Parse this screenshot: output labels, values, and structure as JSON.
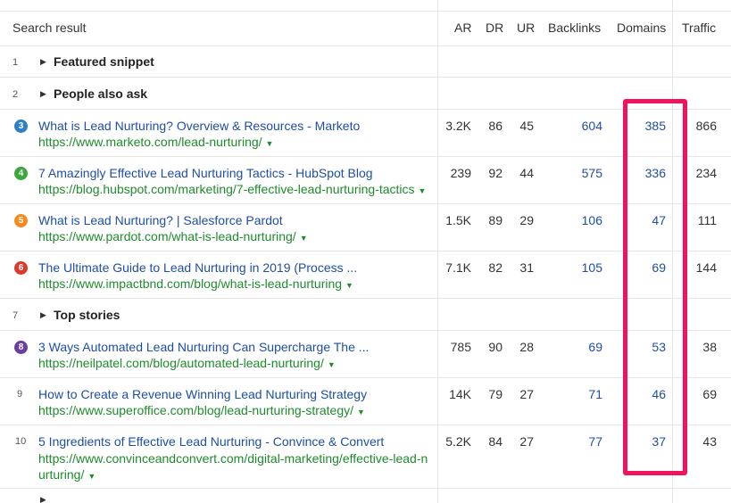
{
  "header": {
    "search_result": "Search result",
    "ar": "AR",
    "dr": "DR",
    "ur": "UR",
    "backlinks": "Backlinks",
    "domains": "Domains",
    "traffic": "Traffic"
  },
  "sections": [
    {
      "index": "1",
      "label": "Featured snippet"
    },
    {
      "index": "2",
      "label": "People also ask"
    },
    {
      "index": "7",
      "label": "Top stories"
    }
  ],
  "results": [
    {
      "pos": "3",
      "color": "#2e7fc6",
      "title": "What is Lead Nurturing? Overview & Resources - Marketo",
      "url": "https://www.marketo.com/lead-nurturing/",
      "ar": "3.2K",
      "dr": "86",
      "ur": "45",
      "backlinks": "604",
      "domains": "385",
      "traffic": "866"
    },
    {
      "pos": "4",
      "color": "#3aa83a",
      "title": "7 Amazingly Effective Lead Nurturing Tactics - HubSpot Blog",
      "url": "https://blog.hubspot.com/marketing/7-effective-lead-nurturing-tactics",
      "ar": "239",
      "dr": "92",
      "ur": "44",
      "backlinks": "575",
      "domains": "336",
      "traffic": "234"
    },
    {
      "pos": "5",
      "color": "#f58a1f",
      "title": "What is Lead Nurturing? | Salesforce Pardot",
      "url": "https://www.pardot.com/what-is-lead-nurturing/",
      "ar": "1.5K",
      "dr": "89",
      "ur": "29",
      "backlinks": "106",
      "domains": "47",
      "traffic": "111"
    },
    {
      "pos": "6",
      "color": "#d93a2b",
      "title": "The Ultimate Guide to Lead Nurturing in 2019 (Process ...",
      "url": "https://www.impactbnd.com/blog/what-is-lead-nurturing",
      "ar": "7.1K",
      "dr": "82",
      "ur": "31",
      "backlinks": "105",
      "domains": "69",
      "traffic": "144"
    },
    {
      "pos": "8",
      "color": "#6b3fa0",
      "title": "3 Ways Automated Lead Nurturing Can Supercharge The ...",
      "url": "https://neilpatel.com/blog/automated-lead-nurturing/",
      "ar": "785",
      "dr": "90",
      "ur": "28",
      "backlinks": "69",
      "domains": "53",
      "traffic": "38"
    },
    {
      "pos": "9",
      "color": "",
      "title": "How to Create a Revenue Winning Lead Nurturing Strategy",
      "url": "https://www.superoffice.com/blog/lead-nurturing-strategy/",
      "ar": "14K",
      "dr": "79",
      "ur": "27",
      "backlinks": "71",
      "domains": "46",
      "traffic": "69"
    },
    {
      "pos": "10",
      "color": "",
      "title": "5 Ingredients of Effective Lead Nurturing - Convince & Convert",
      "url": "https://www.convinceandconvert.com/digital-marketing/effective-lead-nurturing/",
      "ar": "5.2K",
      "dr": "84",
      "ur": "27",
      "backlinks": "77",
      "domains": "37",
      "traffic": "43"
    }
  ],
  "highlight_color": "#f0145f"
}
